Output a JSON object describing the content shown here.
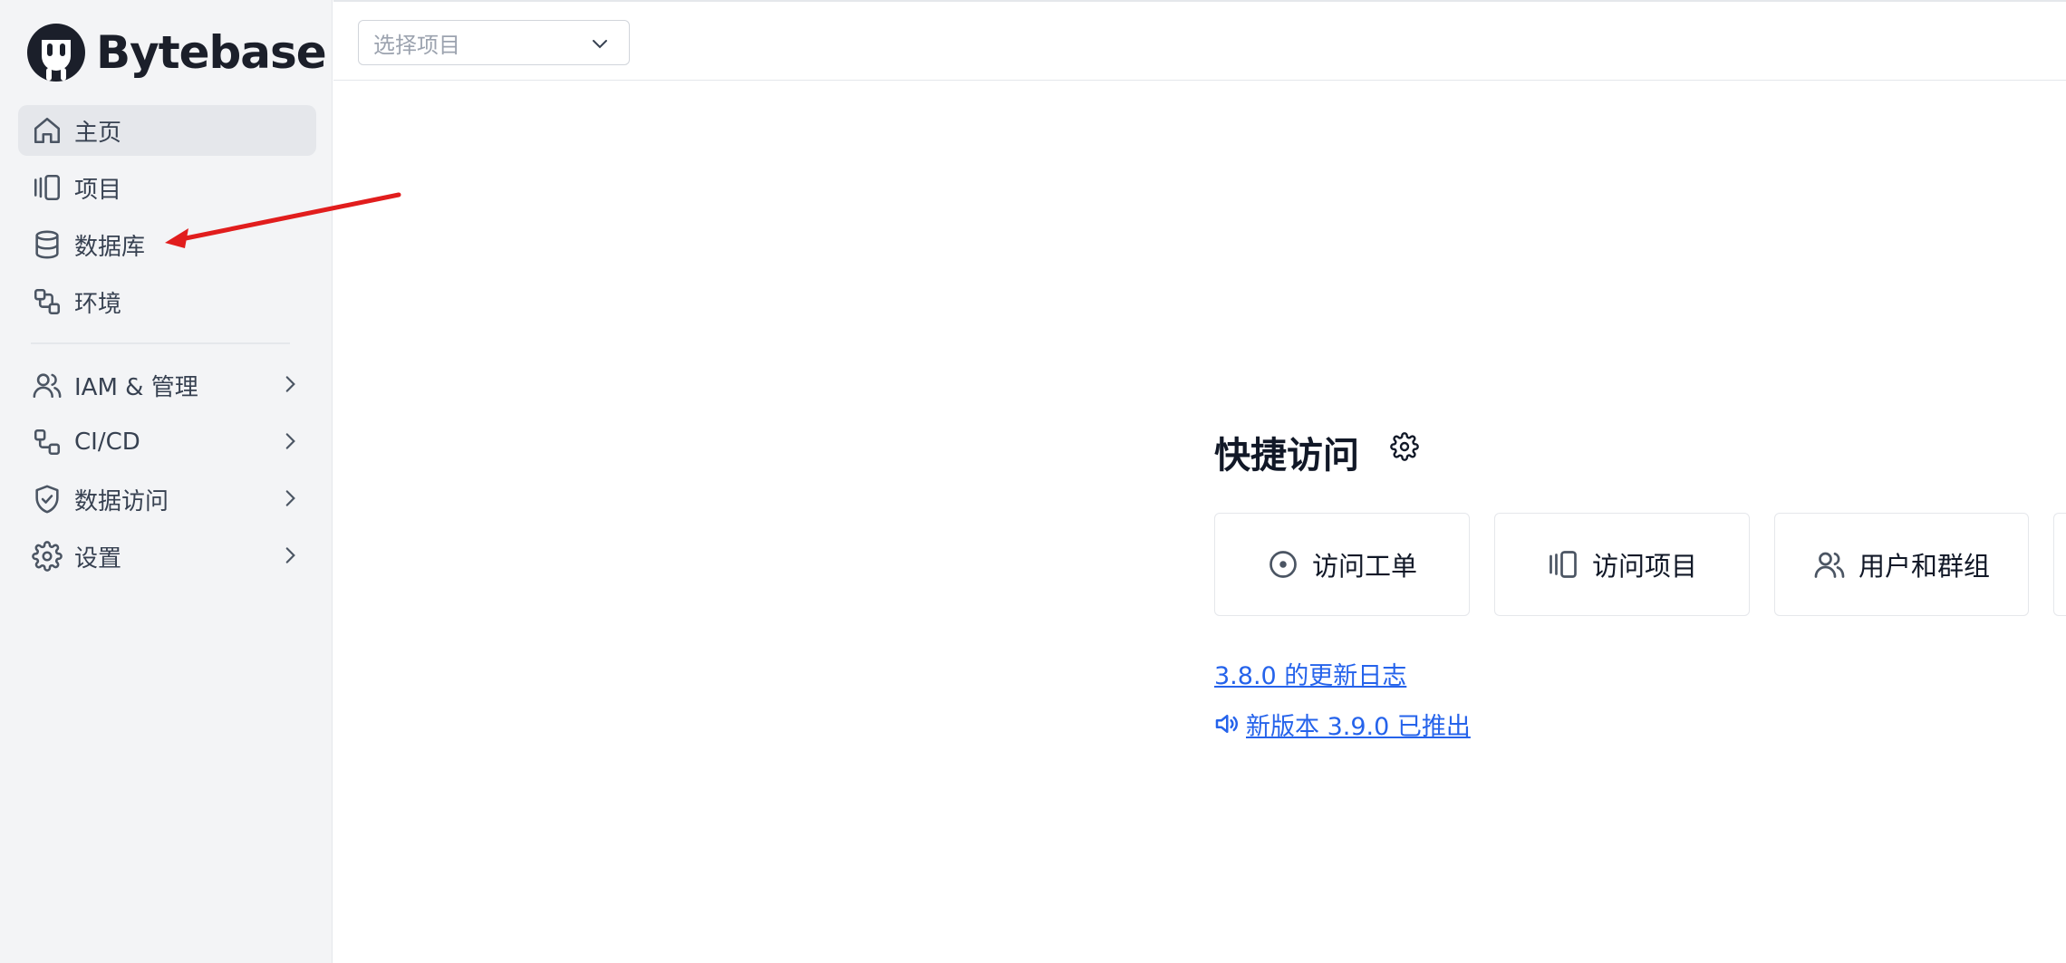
{
  "brand": {
    "name": "Bytebase"
  },
  "sidebar": {
    "items": [
      {
        "label": "主页",
        "icon": "home-icon",
        "active": true
      },
      {
        "label": "项目",
        "icon": "project-icon",
        "active": false
      },
      {
        "label": "数据库",
        "icon": "database-icon",
        "active": false
      },
      {
        "label": "环境",
        "icon": "environment-icon",
        "active": false
      }
    ],
    "groups": [
      {
        "label": "IAM & 管理",
        "icon": "users-icon"
      },
      {
        "label": "CI/CD",
        "icon": "cicd-icon"
      },
      {
        "label": "数据访问",
        "icon": "shield-check-icon"
      },
      {
        "label": "设置",
        "icon": "gear-icon"
      }
    ]
  },
  "topbar": {
    "project_select": {
      "placeholder": "选择项目"
    }
  },
  "quick_access": {
    "title": "快捷访问",
    "cards": [
      {
        "label": "访问工单",
        "icon": "issue-circle-icon"
      },
      {
        "label": "访问项目",
        "icon": "project-icon"
      },
      {
        "label": "用户和群组",
        "icon": "users-icon"
      }
    ],
    "changelog_link": "3.8.0 的更新日志",
    "release_link": "新版本 3.9.0 已推出"
  },
  "colors": {
    "sidebar_bg": "#f3f4f6",
    "active_item_bg": "#e5e7eb",
    "link": "#2563eb",
    "annotation_arrow": "#e11d1d"
  }
}
